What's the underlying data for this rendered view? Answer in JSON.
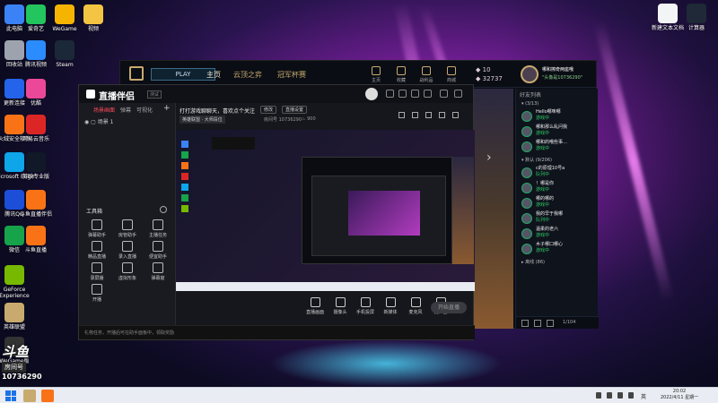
{
  "desktop": {
    "icons_left": [
      {
        "label": "此电脑",
        "color": "#3b82f6"
      },
      {
        "label": "爱奇艺",
        "color": "#22c55e"
      },
      {
        "label": "WeGame",
        "color": "#f4b400"
      },
      {
        "label": "视频",
        "color": "#f4c542"
      },
      {
        "label": "回收站",
        "color": "#9ca3af"
      },
      {
        "label": "腾讯视频",
        "color": "#2a8cff"
      },
      {
        "label": "Steam",
        "color": "#1b2838"
      },
      {
        "label": "更新连接",
        "color": "#2563eb"
      },
      {
        "label": "优酷",
        "color": "#ec4899"
      },
      {
        "label": "火绒安全软件",
        "color": "#f97316"
      },
      {
        "label": "网易云音乐",
        "color": "#dc2626"
      },
      {
        "label": "Microsoft Edge",
        "color": "#0ea5e9"
      },
      {
        "label": "剪映专业版",
        "color": "#111827"
      },
      {
        "label": "腾讯QQ",
        "color": "#1d4ed8"
      },
      {
        "label": "斗鱼直播伴侣",
        "color": "#f97316"
      },
      {
        "label": "微信",
        "color": "#16a34a"
      },
      {
        "label": "斗鱼直播",
        "color": "#f97316"
      },
      {
        "label": "GeForce Experience",
        "color": "#76b900"
      },
      {
        "label": "英雄联盟",
        "color": "#c8aa6e"
      },
      {
        "label": "WeGame版",
        "color": "#333333"
      }
    ],
    "icons_right": [
      {
        "label": "新建文本文档",
        "color": "#f3f4f6"
      },
      {
        "label": "计算器",
        "color": "#1f2937"
      }
    ]
  },
  "game_client": {
    "play_label": "PLAY",
    "tabs": [
      "主页",
      "云顶之弈",
      "冠军杯赛"
    ],
    "nav": [
      "主页",
      "收藏",
      "战利品",
      "商城"
    ],
    "currency_rp": "10",
    "currency_be": "32737",
    "user_name": "哪和擦奇两座哦",
    "user_status": "\"头像是10736290\"",
    "friends_header": "好友列表",
    "group_general": "▾ (3/13)",
    "group_offline": "▾ 默认 (9/206)",
    "group_mobile": "▸ 离线 (86)",
    "friends": [
      {
        "name": "Hello哪咪哪",
        "status": "游戏中"
      },
      {
        "name": "哪和那么乱问我",
        "status": "游戏中"
      },
      {
        "name": "哪和的哦些事…",
        "status": "游戏中"
      },
      {
        "name": "c的原理10号a",
        "status": "队列中"
      },
      {
        "name": "！哪是你",
        "status": "游戏中"
      },
      {
        "name": "哪的哪的",
        "status": "游戏中"
      },
      {
        "name": "我的早于我哪",
        "status": "队列中"
      },
      {
        "name": "温柔的老六",
        "status": "游戏中"
      },
      {
        "name": "木子哪口哪心",
        "status": "游戏中"
      }
    ],
    "side_footer_text": "1/104"
  },
  "streamer": {
    "app_name": "直播伴侣",
    "version_badge": "测试",
    "left_tabs": [
      "场景画面",
      "弹幕",
      "可视化"
    ],
    "scene_item": "场景 1",
    "tools_title": "工具箱",
    "tools": [
      "弹幕助手",
      "房管助手",
      "主播任务",
      "精品直播",
      "录入直播",
      "便宜助手",
      "录屏播",
      "虚拟形象",
      "弹幕窗",
      "开播"
    ],
    "room_title": "打打游戏聊聊天，喜欢点个关注",
    "room_edit_btn": "修改",
    "room_settings_btn": "直播设置",
    "category": "英雄联盟 · 大师段位",
    "room_id": "房间号 10736290",
    "popularity": "900",
    "controls": [
      "直播画面",
      "摄像头",
      "手机投屏",
      "新媒体",
      "麦克风",
      "扬声器"
    ],
    "go_live_label": "开始直播",
    "status_bar": "礼物任务，开播后可在助手面板中，领取奖励"
  },
  "watermark": {
    "logo": "斗鱼",
    "sub": "房间号",
    "room": "10736290"
  },
  "taskbar": {
    "time": "20:02",
    "date": "2022/4/11 星期一",
    "lang": "英"
  }
}
